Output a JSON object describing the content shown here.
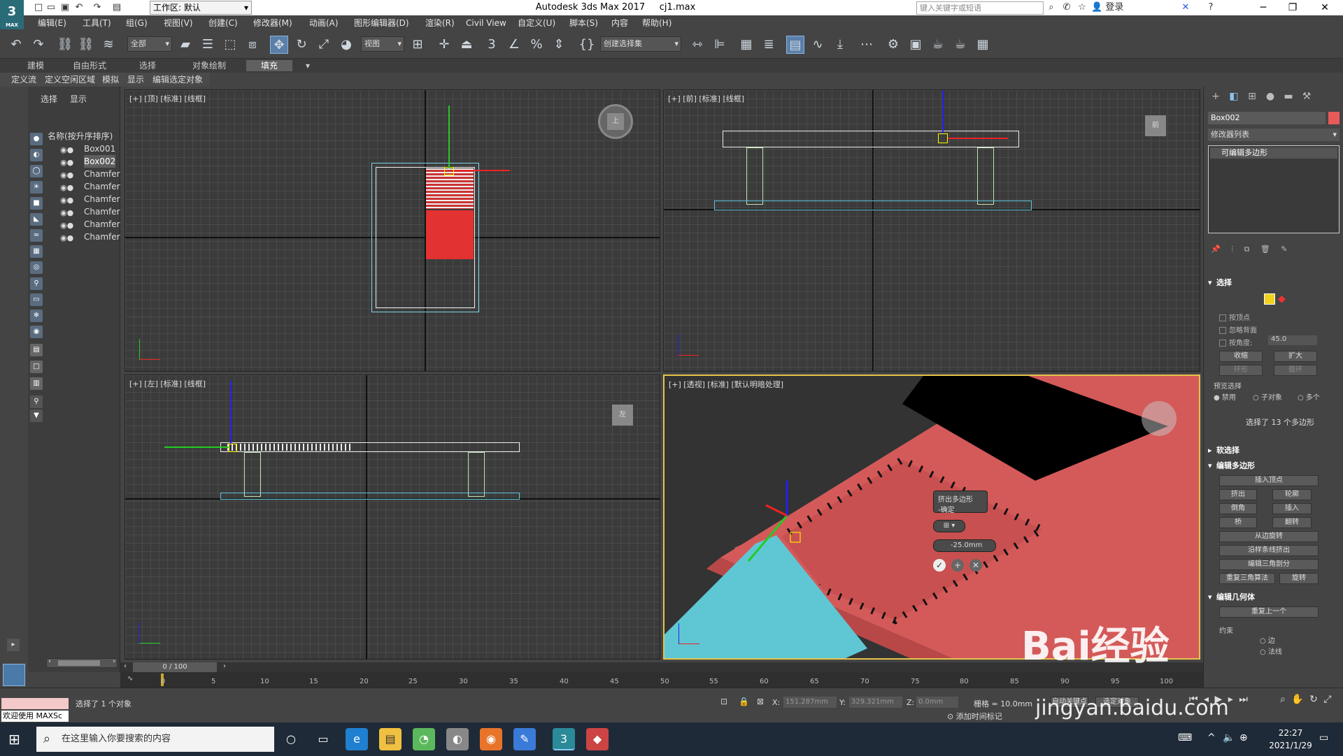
{
  "titlebar": {
    "app_icon": "3",
    "app_icon_sub": "MAX",
    "workspace": "工作区: 默认",
    "title": "Autodesk 3ds Max 2017",
    "filename": "cj1.max",
    "search_placeholder": "键入关键字或短语",
    "login": "登录"
  },
  "menu": [
    "编辑(E)",
    "工具(T)",
    "组(G)",
    "视图(V)",
    "创建(C)",
    "修改器(M)",
    "动画(A)",
    "图形编辑器(D)",
    "渲染(R)",
    "Civil View",
    "自定义(U)",
    "脚本(S)",
    "内容",
    "帮助(H)"
  ],
  "toolbar": {
    "filter": "全部",
    "ref_coord": "视图",
    "selection_set": "创建选择集"
  },
  "ribbon_tabs": [
    "建模",
    "自由形式",
    "选择",
    "对象绘制",
    "填充"
  ],
  "ribbon_active": "填充",
  "ribbon2": [
    "定义流",
    "定义空闲区域",
    "模拟",
    "显示",
    "编辑选定对象"
  ],
  "scene": {
    "tabs": [
      "选择",
      "显示"
    ],
    "column": "名称(按升序排序)",
    "items": [
      "Box001",
      "Box002",
      "Chamfer",
      "Chamfer",
      "Chamfer",
      "Chamfer",
      "Chamfer",
      "Chamfer"
    ],
    "selected": "Box002"
  },
  "viewports": {
    "top": "[+] [顶] [标准] [线框]",
    "front": "[+] [前] [标准] [线框]",
    "left": "[+] [左] [标准] [线框]",
    "persp": "[+] [透视] [标准] [默认明暗处理]",
    "cube_top": "上",
    "cube_front": "前",
    "cube_left": "左",
    "persp_caddy_title": "挤出多边形",
    "persp_caddy_sub": "-确定",
    "persp_caddy_value": "-25.0mm"
  },
  "cmdpanel": {
    "object_name": "Box002",
    "modifier_list": "修改器列表",
    "stack_item": "可编辑多边形",
    "sel_head": "选择",
    "by_vertex": "按顶点",
    "ignore_back": "忽略背面",
    "by_angle": "按角度:",
    "angle_val": "45.0",
    "shrink": "收缩",
    "grow": "扩大",
    "ring": "环形",
    "loop": "循环",
    "preview": "预览选择",
    "disabled": "禁用",
    "subobj": "子对象",
    "multi": "多个",
    "sel_count": "选择了 13 个多边形",
    "soft_sel": "软选择",
    "edit_poly": "编辑多边形",
    "insert_vertex": "插入顶点",
    "extrude": "挤出",
    "outline": "轮廓",
    "bevel": "倒角",
    "inset": "插入",
    "bridge": "桥",
    "flip": "翻转",
    "hinge": "从边旋转",
    "extrude_spline": "沿样条线挤出",
    "edit_tri": "编辑三角剖分",
    "retri": "重复三角算法",
    "turn": "旋转",
    "edit_geom": "编辑几何体",
    "repeat_last": "重复上一个",
    "constraints": "约束",
    "edge": "边",
    "normal": "法线"
  },
  "timeline": {
    "frame": "0 / 100",
    "ticks": [
      "0",
      "5",
      "10",
      "15",
      "20",
      "25",
      "30",
      "35",
      "40",
      "45",
      "50",
      "55",
      "60",
      "65",
      "70",
      "75",
      "80",
      "85",
      "90",
      "95",
      "100"
    ]
  },
  "status": {
    "welcome": "欢迎使用 MAXSc",
    "message": "选择了 1 个对象",
    "x_label": "X:",
    "x_val": "151.287mm",
    "y_label": "Y:",
    "y_val": "329.321mm",
    "z_label": "Z:",
    "z_val": "0.0mm",
    "grid": "栅格 = 10.0mm",
    "add_time_tag": "添加时间标记",
    "auto_key": "自动关键点",
    "set_key": "选定对象"
  },
  "taskbar": {
    "search": "在这里输入你要搜索的内容",
    "time": "22:27",
    "date": "2021/1/29"
  },
  "watermark": {
    "brand": "Bai经验",
    "url": "jingyan.baidu.com"
  }
}
